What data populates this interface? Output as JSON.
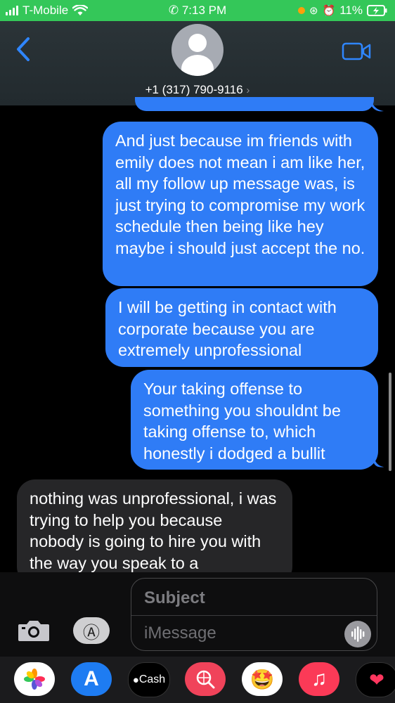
{
  "status_bar": {
    "carrier": "T-Mobile",
    "time": "7:13 PM",
    "battery": "11%"
  },
  "header": {
    "contact": "+1 (317) 790-9116"
  },
  "messages": [
    {
      "direction": "outgoing",
      "text": "And just because im friends with emily does not mean i am like her, all my follow up message was, is just trying to compromise my work schedule then being like hey maybe i should just accept the no."
    },
    {
      "direction": "outgoing",
      "text": "I will be getting in contact with corporate because you are extremely unprofessional"
    },
    {
      "direction": "outgoing",
      "text": "Your taking offense to something you shouldnt be taking offense to, which honestly i dodged a bullit"
    },
    {
      "direction": "incoming",
      "text": "nothing was unprofessional, i was trying to help you because nobody is going to hire you with the way you speak to a"
    }
  ],
  "composer": {
    "subject_placeholder": "Subject",
    "message_placeholder": "iMessage"
  },
  "app_drawer": {
    "cash_label": "Cash"
  },
  "colors": {
    "status_bar": "#34c759",
    "outgoing_bubble": "#2f7cf6",
    "incoming_bubble": "#262628",
    "accent": "#2f86ff"
  }
}
